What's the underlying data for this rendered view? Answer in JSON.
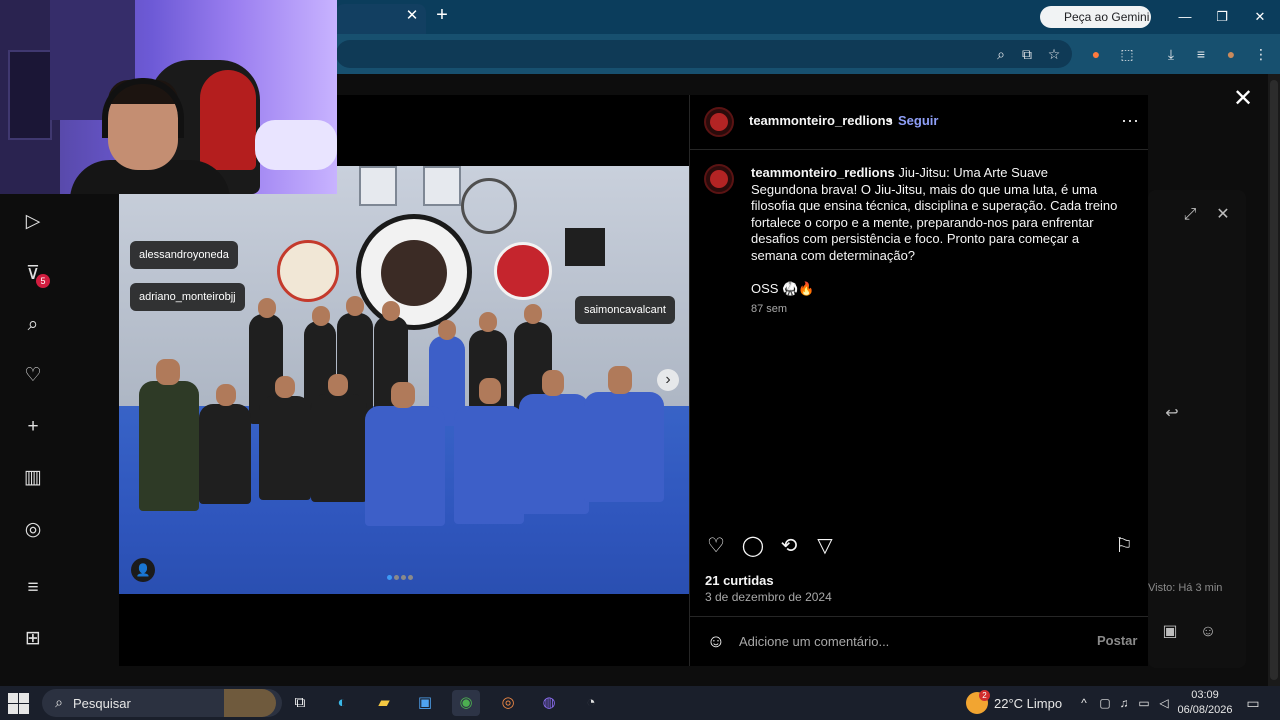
{
  "browser": {
    "tab_close": "✕",
    "new_tab": "+",
    "gemini_button": "Peça ao Gemini",
    "window_controls": {
      "minimize": "—",
      "maximize": "❐",
      "close": "✕"
    }
  },
  "post": {
    "username": "teammonteiro_redlions",
    "separator": "•",
    "follow": "Seguir",
    "more": "···",
    "caption_title": "Jiu-Jitsu: Uma Arte Suave",
    "caption_body": "Segundona brava! O Jiu-Jitsu, mais do que uma luta, é uma filosofia que ensina técnica, disciplina e superação. Cada treino fortalece o corpo e a mente, preparando-nos para enfrentar desafios com persistência e foco. Pronto para começar a semana com determinação?",
    "caption_oss": "OSS 🥋🔥",
    "caption_time": "87 sem",
    "likes": "21 curtidas",
    "date": "3 de dezembro de 2024",
    "comment_placeholder": "Adicione um comentário...",
    "post_button": "Postar",
    "photo_tags": [
      "alessandroyoneda",
      "adriano_monteirobjj",
      "saimoncavalcant"
    ],
    "carousel_count": 4,
    "carousel_active": 1
  },
  "sidebar": {
    "icons": [
      "reels-icon",
      "send-icon",
      "search-icon",
      "heart-icon",
      "plus-icon",
      "insights-icon",
      "threads-icon",
      "menu-icon",
      "grid-icon"
    ],
    "notification_count": "5"
  },
  "background_dm": {
    "seen_text": "Visto: Há 3 min"
  },
  "taskbar": {
    "search_label": "Pesquisar",
    "weather": "22°C  Limpo",
    "weather_badge": "2",
    "time": "03:09",
    "date": "06/08/2026"
  },
  "overlay": {
    "close": "✕"
  }
}
